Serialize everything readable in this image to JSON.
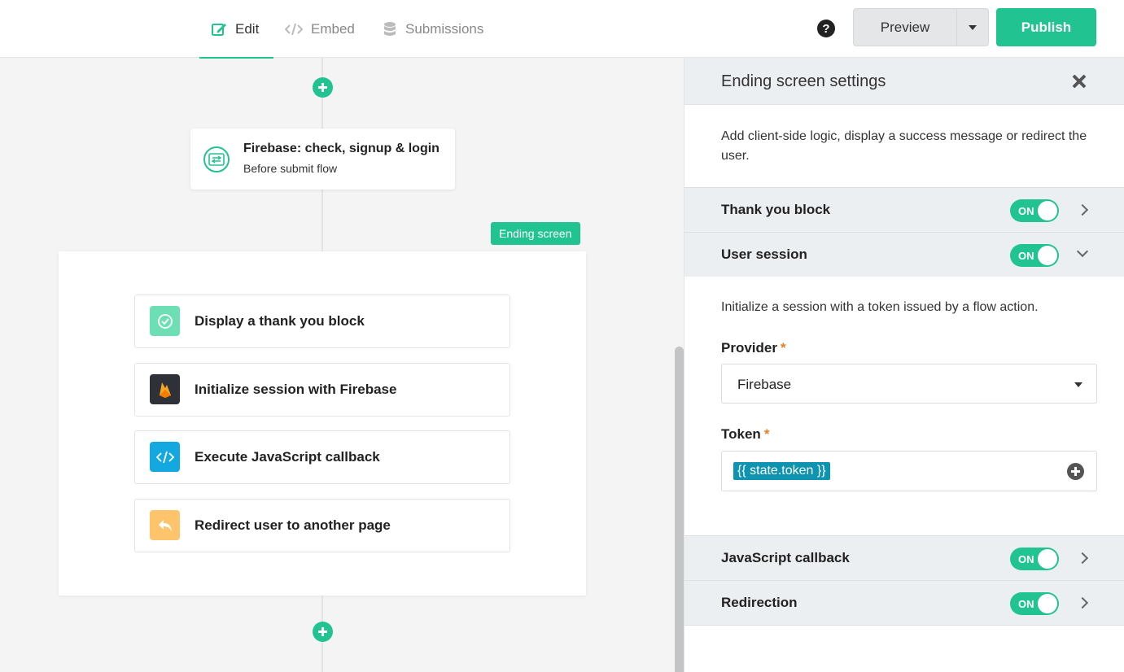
{
  "topbar": {
    "tabs": [
      {
        "label": "Edit",
        "icon": "edit-icon",
        "active": true
      },
      {
        "label": "Embed",
        "icon": "code-icon",
        "active": false
      },
      {
        "label": "Submissions",
        "icon": "database-icon",
        "active": false
      }
    ],
    "help_glyph": "?",
    "preview_label": "Preview",
    "publish_label": "Publish"
  },
  "canvas": {
    "action": {
      "title": "Firebase: check, signup & login",
      "subtitle": "Before submit flow",
      "icon": "flow-icon"
    },
    "ending_badge": "Ending screen",
    "steps": [
      {
        "label": "Display a thank you block",
        "icon": "check-circle-icon",
        "color": "#6ddfb5"
      },
      {
        "label": "Initialize session with Firebase",
        "icon": "firebase-icon",
        "color": "#2e3238"
      },
      {
        "label": "Execute JavaScript callback",
        "icon": "code-icon",
        "color": "#14a8e0"
      },
      {
        "label": "Redirect user to another page",
        "icon": "reply-icon",
        "color": "#fdc46b"
      }
    ]
  },
  "panel": {
    "title": "Ending screen settings",
    "description": "Add client-side logic, display a success message or redirect the user.",
    "sections": [
      {
        "label": "Thank you block",
        "toggle": "ON",
        "expanded": false
      },
      {
        "label": "User session",
        "toggle": "ON",
        "expanded": true
      },
      {
        "label": "JavaScript callback",
        "toggle": "ON",
        "expanded": false
      },
      {
        "label": "Redirection",
        "toggle": "ON",
        "expanded": false
      }
    ],
    "session": {
      "description": "Initialize a session with a token issued by a flow action.",
      "provider_label": "Provider",
      "provider_value": "Firebase",
      "token_label": "Token",
      "token_value": "{{ state.token }}",
      "required_mark": "*"
    }
  },
  "colors": {
    "accent": "#21c490",
    "token_chip": "#0e93b0"
  }
}
